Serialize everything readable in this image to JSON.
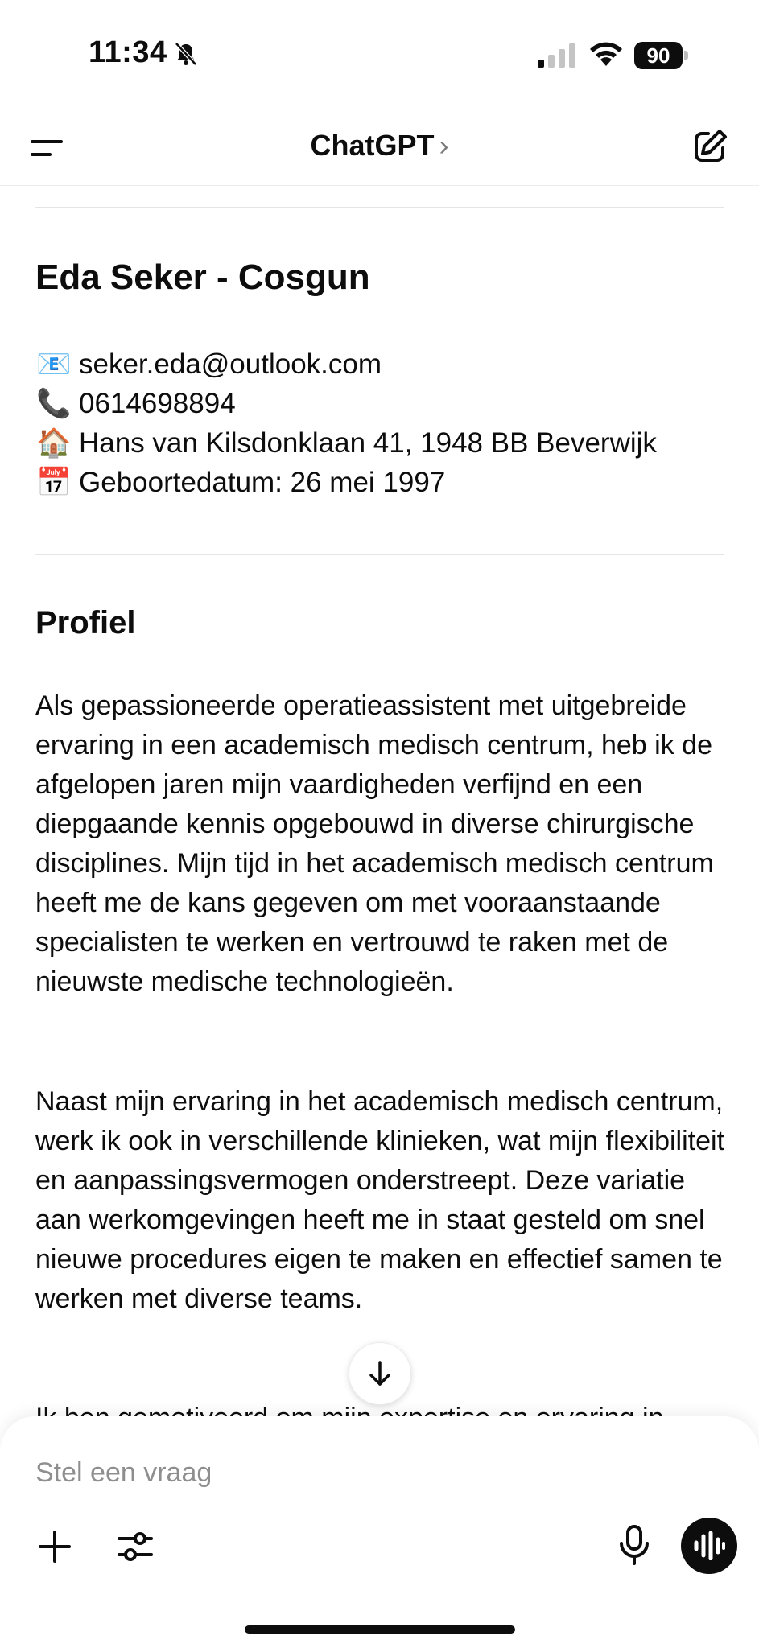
{
  "status_bar": {
    "time": "11:34",
    "battery": "90",
    "icons": [
      "bell-slash-icon",
      "signal-icon",
      "wifi-icon",
      "battery-icon"
    ]
  },
  "nav": {
    "title": "ChatGPT",
    "chevron": "›",
    "icons": [
      "menu-icon",
      "compose-icon"
    ]
  },
  "message": {
    "name": "Eda Seker - Cosgun",
    "contact": [
      {
        "emoji": "📧",
        "text": "seker.eda@outlook.com"
      },
      {
        "emoji": "📞",
        "text": "0614698894"
      },
      {
        "emoji": "🏠",
        "text": "Hans van Kilsdonklaan 41, 1948 BB Beverwijk"
      },
      {
        "emoji": "📅",
        "text": "Geboortedatum: 26 mei 1997"
      }
    ],
    "section_title": "Profiel",
    "paragraph_1": "Als gepassioneerde operatieassistent met uitgebreide ervaring in een academisch medisch centrum, heb ik de afgelopen jaren mijn vaardigheden verfijnd en een diepgaande kennis opgebouwd in diverse chirurgische disciplines. Mijn tijd in het academisch medisch centrum heeft me de kans gegeven om met vooraanstaande specialisten te werken en vertrouwd te raken met de nieuwste medische technologieën.",
    "paragraph_2": "Naast mijn ervaring in het academisch medisch centrum, werk ik ook in verschillende klinieken, wat mijn flexibiliteit en aanpassingsvermogen onderstreept. Deze variatie aan werkomgevingen heeft me in staat gesteld om snel nieuwe procedures eigen te maken en effectief samen te werken met diverse teams.",
    "paragraph_3": "Ik ben gemotiveerd om mijn expertise en ervaring in"
  },
  "composer": {
    "placeholder": "Stel een vraag",
    "icons": [
      "plus-icon",
      "tools-icon",
      "mic-icon",
      "voice-mode-icon"
    ]
  },
  "scroll_button_icon": "arrow-down-icon"
}
